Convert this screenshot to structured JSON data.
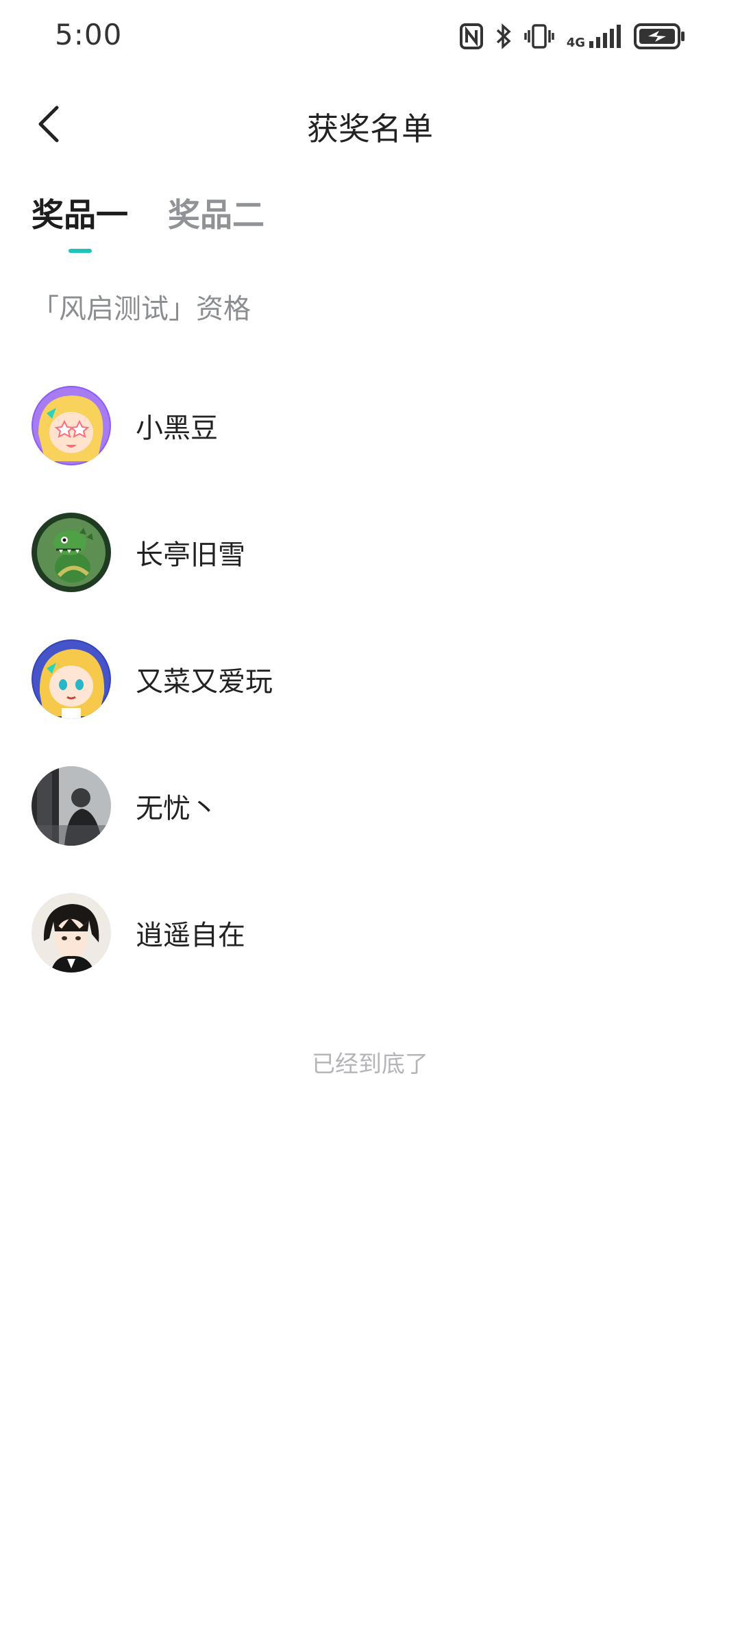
{
  "status_bar": {
    "time": "5:00",
    "network": "4G",
    "icons": [
      "nfc-icon",
      "bluetooth-icon",
      "vibrate-icon",
      "signal-icon",
      "battery-charging-icon"
    ]
  },
  "header": {
    "title": "获奖名单",
    "back_icon": "chevron-left-icon"
  },
  "tabs": [
    {
      "label": "奖品一",
      "active": true
    },
    {
      "label": "奖品二",
      "active": false
    }
  ],
  "section": {
    "label": "「风启测试」资格"
  },
  "winners": [
    {
      "name": "小黑豆",
      "avatar": "anime-blonde-girl-star-avatar"
    },
    {
      "name": "长亭旧雪",
      "avatar": "green-dragon-avatar"
    },
    {
      "name": "又菜又爱玩",
      "avatar": "anime-blonde-girl-avatar"
    },
    {
      "name": "无忧丶",
      "avatar": "dark-photo-avatar"
    },
    {
      "name": "逍遥自在",
      "avatar": "anime-boy-avatar"
    }
  ],
  "footer": {
    "end_text": "已经到底了"
  },
  "colors": {
    "accent": "#1ec3b9",
    "inactive_tab": "#8f9296",
    "muted_text": "#b3b5b8"
  }
}
